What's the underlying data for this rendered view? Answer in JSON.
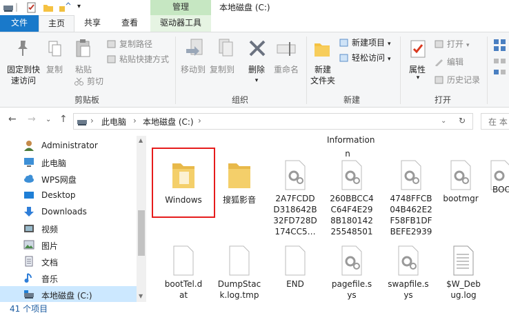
{
  "window": {
    "title": "本地磁盘 (C:)",
    "context_tab": "管理"
  },
  "tabs": {
    "file": "文件",
    "home": "主页",
    "share": "共享",
    "view": "查看",
    "drive_tools": "驱动器工具"
  },
  "ribbon": {
    "clipboard": {
      "group_label": "剪贴板",
      "pin_quick": "固定到快\n速访问",
      "copy": "复制",
      "paste": "粘贴",
      "copy_path": "复制路径",
      "paste_shortcut": "粘贴快捷方式",
      "cut": "剪切"
    },
    "organize": {
      "group_label": "组织",
      "move_to": "移动到",
      "copy_to": "复制到",
      "delete": "删除",
      "rename": "重命名"
    },
    "new": {
      "group_label": "新建",
      "new_folder": "新建\n文件夹",
      "new_item": "新建项目",
      "easy_access": "轻松访问"
    },
    "open": {
      "group_label": "打开",
      "properties": "属性",
      "open": "打开",
      "edit": "编辑",
      "history": "历史记录"
    }
  },
  "address": {
    "segments": [
      "此电脑",
      "本地磁盘 (C:)"
    ],
    "search_placeholder": "在 本"
  },
  "nav": {
    "items": [
      {
        "label": "Administrator",
        "icon": "user-icon"
      },
      {
        "label": "此电脑",
        "icon": "computer-icon"
      },
      {
        "label": "WPS网盘",
        "icon": "cloud-icon"
      },
      {
        "label": "Desktop",
        "icon": "desktop-icon"
      },
      {
        "label": "Downloads",
        "icon": "download-icon"
      },
      {
        "label": "视频",
        "icon": "video-icon"
      },
      {
        "label": "图片",
        "icon": "pictures-icon"
      },
      {
        "label": "文档",
        "icon": "documents-icon"
      },
      {
        "label": "音乐",
        "icon": "music-icon"
      },
      {
        "label": "本地磁盘 (C:)",
        "icon": "drive-icon"
      }
    ]
  },
  "files": {
    "partial_top": "Information",
    "row1": [
      {
        "name": "Windows",
        "type": "folder"
      },
      {
        "name": "搜狐影音",
        "type": "folder"
      },
      {
        "name": "2A7FCDD\nD318642B\n32FD728D\n174CC5…",
        "type": "sys"
      },
      {
        "name": "260BBCC4\nC64F4E29\n8B180142\n25548501",
        "type": "sys"
      },
      {
        "name": "4748FFCB\n04B462E2\nF58FB1DF\nBEFE2939",
        "type": "sys"
      },
      {
        "name": "bootmgr",
        "type": "sys"
      },
      {
        "name": "BOO",
        "type": "sys"
      }
    ],
    "row2": [
      {
        "name": "bootTel.d\nat",
        "type": "file"
      },
      {
        "name": "DumpStac\nk.log.tmp",
        "type": "file"
      },
      {
        "name": "END",
        "type": "file"
      },
      {
        "name": "pagefile.s\nys",
        "type": "sys"
      },
      {
        "name": "swapfile.s\nys",
        "type": "sys"
      },
      {
        "name": "$W_Deb\nug.log",
        "type": "text"
      }
    ]
  },
  "status": {
    "count": "41 个项目"
  }
}
